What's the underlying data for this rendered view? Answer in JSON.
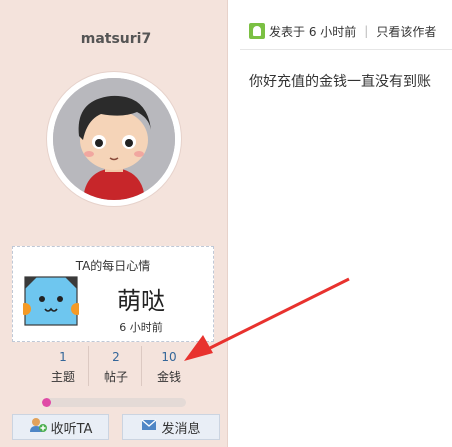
{
  "profile": {
    "username": "matsuri7",
    "avatar_icon": "cartoon-boy-avatar"
  },
  "mood": {
    "title": "TA的每日心情",
    "value": "萌哒",
    "time": "6 小时前",
    "icon": "blue-cat-face-icon"
  },
  "stats": [
    {
      "num": "1",
      "label": "主题"
    },
    {
      "num": "2",
      "label": "帖子"
    },
    {
      "num": "10",
      "label": "金钱"
    }
  ],
  "progress": {
    "fraction": 0.06,
    "color": "#e04aa6"
  },
  "buttons": {
    "follow": "收听TA",
    "message": "发消息"
  },
  "post": {
    "meta_posted": "发表于 6 小时前",
    "meta_only_author": "只看该作者",
    "body": "你好充值的金钱一直没有到账"
  },
  "annotation": {
    "arrow_color": "#e8322e"
  }
}
